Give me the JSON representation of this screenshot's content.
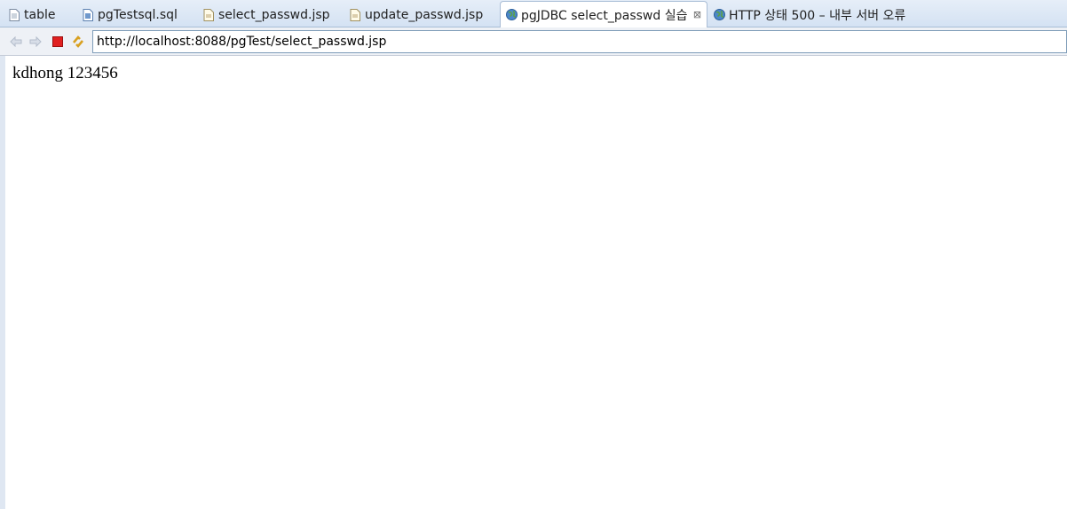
{
  "tabs": [
    {
      "label": "table",
      "icon": "text-file-icon",
      "active": false
    },
    {
      "label": "pgTestsql.sql",
      "icon": "sql-file-icon",
      "active": false
    },
    {
      "label": "select_passwd.jsp",
      "icon": "jsp-file-icon",
      "active": false
    },
    {
      "label": "update_passwd.jsp",
      "icon": "jsp-file-icon",
      "active": false
    },
    {
      "label": "pgJDBC select_passwd 실습",
      "icon": "globe-icon",
      "active": true
    },
    {
      "label": "HTTP 상태 500 – 내부 서버 오류",
      "icon": "globe-icon",
      "active": false
    }
  ],
  "toolbar": {
    "back_icon": "back-arrow-icon",
    "forward_icon": "forward-arrow-icon",
    "stop_icon": "stop-icon",
    "refresh_icon": "refresh-icon",
    "url": "http://localhost:8088/pgTest/select_passwd.jsp"
  },
  "page": {
    "text": "kdhong 123456"
  },
  "colors": {
    "stop": "#e02020",
    "refresh": "#e0a020",
    "tabbar": "#d4e2f3"
  }
}
